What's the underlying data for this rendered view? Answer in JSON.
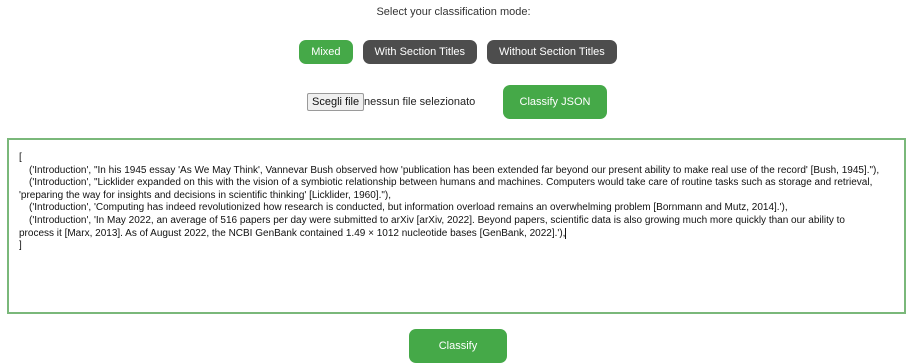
{
  "header": {
    "prompt": "Select your classification mode:"
  },
  "modes": {
    "mixed": "Mixed",
    "with_titles": "With Section Titles",
    "without_titles": "Without Section Titles",
    "active": "Mixed"
  },
  "file": {
    "choose_label": "Scegli file",
    "status": "nessun file selezionato"
  },
  "buttons": {
    "classify_json": "Classify JSON",
    "classify": "Classify"
  },
  "editor": {
    "lines": [
      "[",
      "('Introduction', \"In his 1945 essay 'As We May Think', Vannevar Bush observed how 'publication has been extended far beyond our present ability to make real use of the record' [Bush, 1945].\"),",
      "('Introduction', \"Licklider expanded on this with the vision of a symbiotic relationship between humans and machines. Computers would take care of routine tasks such as storage and retrieval,",
      "'preparing the way for insights and decisions in scientific thinking' [Licklider, 1960].\"),",
      "('Introduction', 'Computing has indeed revolutionized how research is conducted, but information overload remains an overwhelming problem [Bornmann and Mutz, 2014].'),",
      "('Introduction', 'In May 2022, an average of 516 papers per day were submitted to arXiv [arXiv, 2022]. Beyond papers, scientific data is also growing much more quickly than our ability to",
      "process it [Marx, 2013]. As of August 2022, the NCBI GenBank contained 1.49 × 1012 nucleotide bases [GenBank, 2022].'),",
      "]"
    ]
  },
  "colors": {
    "accent_green": "#45a948",
    "inactive_dark": "#4d4d4d",
    "editor_border": "#7ab87a"
  }
}
